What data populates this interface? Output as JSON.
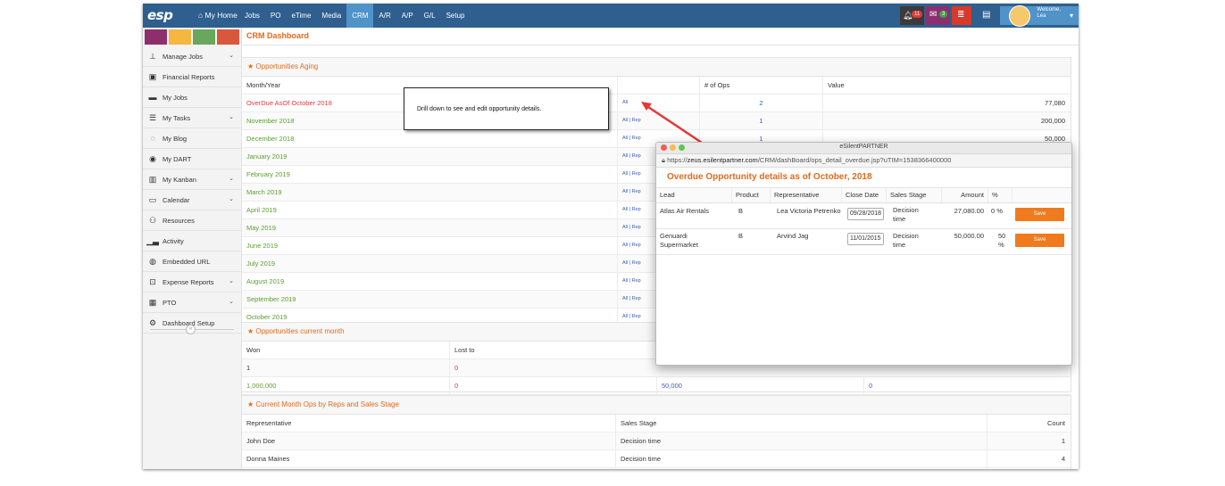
{
  "header": {
    "logo": "esp",
    "home": "⌂ My Home",
    "nav": [
      "Jobs",
      "PO",
      "eTime",
      "Media",
      "CRM",
      "A/R",
      "A/P",
      "G/L",
      "Setup"
    ],
    "active_nav": "CRM",
    "badges": {
      "alerts": "11",
      "messages": "3"
    },
    "welcome_line1": "Welcome,",
    "welcome_line2": "Lea"
  },
  "sidebar": {
    "swatch_colors": [
      "#8e2f6c",
      "#f4b73f",
      "#69a85c",
      "#d9573d"
    ],
    "items": [
      {
        "label": "Manage Jobs",
        "icon": "sitemap-icon",
        "chevron": true
      },
      {
        "label": "Financial Reports",
        "icon": "report-icon",
        "chevron": false
      },
      {
        "label": "My Jobs",
        "icon": "briefcase-icon",
        "chevron": false
      },
      {
        "label": "My Tasks",
        "icon": "tasks-icon",
        "chevron": true
      },
      {
        "label": "My Blog",
        "icon": "chat-icon",
        "chevron": false
      },
      {
        "label": "My DART",
        "icon": "dart-icon",
        "chevron": false
      },
      {
        "label": "My Kanban",
        "icon": "map-icon",
        "chevron": true
      },
      {
        "label": "Calendar",
        "icon": "calendar-icon",
        "chevron": true
      },
      {
        "label": "Resources",
        "icon": "people-icon",
        "chevron": false
      },
      {
        "label": "Activity",
        "icon": "signal-icon",
        "chevron": false
      },
      {
        "label": "Embedded URL",
        "icon": "globe-icon",
        "chevron": false
      },
      {
        "label": "Expense Reports",
        "icon": "money-icon",
        "chevron": true
      },
      {
        "label": "PTO",
        "icon": "pto-calendar-icon",
        "chevron": true
      },
      {
        "label": "Dashboard Setup",
        "icon": "cogs-icon",
        "chevron": false
      }
    ]
  },
  "page": {
    "title": "CRM Dashboard"
  },
  "aging": {
    "title": "★ Opportunities Aging",
    "columns": [
      "Month/Year",
      "",
      "# of Ops",
      "Value"
    ],
    "rows": [
      {
        "month": "OverDue AsOf October 2018",
        "links": "All",
        "ops": "2",
        "value": "77,080",
        "overdue": true
      },
      {
        "month": "November 2018",
        "links": "All | Rep",
        "ops": "1",
        "value": "200,000"
      },
      {
        "month": "December 2018",
        "links": "All | Rep",
        "ops": "1",
        "value": "50,000"
      },
      {
        "month": "January 2019",
        "links": "All | Rep",
        "ops": "",
        "value": ""
      },
      {
        "month": "February 2019",
        "links": "All | Rep",
        "ops": "",
        "value": ""
      },
      {
        "month": "March 2019",
        "links": "All | Rep",
        "ops": "",
        "value": ""
      },
      {
        "month": "April 2019",
        "links": "All | Rep",
        "ops": "",
        "value": ""
      },
      {
        "month": "May 2019",
        "links": "All | Rep",
        "ops": "",
        "value": ""
      },
      {
        "month": "June 2019",
        "links": "All | Rep",
        "ops": "",
        "value": ""
      },
      {
        "month": "July 2019",
        "links": "All | Rep",
        "ops": "",
        "value": ""
      },
      {
        "month": "August 2019",
        "links": "All | Rep",
        "ops": "",
        "value": ""
      },
      {
        "month": "September 2019",
        "links": "All | Rep",
        "ops": "",
        "value": ""
      },
      {
        "month": "October 2019",
        "links": "All | Rep",
        "ops": "",
        "value": ""
      }
    ]
  },
  "current": {
    "title": "★ Opportunities current month",
    "columns": [
      "Won",
      "Lost to"
    ],
    "row1": [
      "1",
      "0"
    ],
    "row2": [
      "1,000,000",
      "0",
      "50,000",
      "0"
    ]
  },
  "reps": {
    "title": "★ Current Month Ops by Reps and Sales Stage",
    "columns": [
      "Representative",
      "Sales Stage",
      "Count"
    ],
    "rows": [
      {
        "rep": "John Doe",
        "stage": "Decision time",
        "count": "1"
      },
      {
        "rep": "Donna Maines",
        "stage": "Decision time",
        "count": "4"
      }
    ]
  },
  "callout": {
    "text": "Drill down to see and edit opportunity details."
  },
  "popup": {
    "window_title": "eSilentPARTNER",
    "url_prefix": "https://",
    "url_domain": "zeus.esilentpartner.com",
    "url_path": "/CRM/dashBoard/ops_detail_overdue.jsp?uTIM=1538366400000",
    "heading": "Overdue Opportunity details as of October, 2018",
    "columns": [
      "Lead",
      "Product",
      "Representative",
      "Close Date",
      "Sales Stage",
      "Amount",
      "%"
    ],
    "rows": [
      {
        "lead": "Atlas Air Rentals",
        "product": "B",
        "rep": "Lea Victoria Petrenko",
        "date": "09/28/2018",
        "stage_line1": "Decision",
        "stage_line2": "time",
        "amount": "27,080.00",
        "pct": "0 %",
        "save": "Save"
      },
      {
        "lead_line1": "Genuardi",
        "lead_line2": "Supermarket",
        "product": "B",
        "rep": "Arvind Jag",
        "date": "11/01/2015",
        "stage_line1": "Decision",
        "stage_line2": "time",
        "amount": "50,000.00",
        "pct_line1": "50",
        "pct_line2": "%",
        "save": "Save"
      }
    ]
  },
  "colors": {
    "topbar": "#2f5f8f",
    "accent": "#e06a1c",
    "save": "#f07b1e",
    "arrow": "#e53935"
  }
}
